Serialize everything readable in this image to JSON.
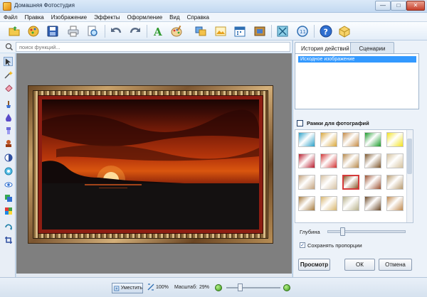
{
  "window": {
    "title": "Домашняя Фотостудия",
    "minimize": "—",
    "maximize": "□",
    "close": "✕"
  },
  "menu": [
    "Файл",
    "Правка",
    "Изображение",
    "Эффекты",
    "Оформление",
    "Вид",
    "Справка"
  ],
  "toolbar": {
    "icons": [
      "open-folder-icon",
      "gallery-icon",
      "save-icon",
      "print-icon",
      "preview-icon",
      "undo-icon",
      "redo-icon",
      "text-icon",
      "palette-icon",
      "collage-icon",
      "postcard-icon",
      "calendar-icon",
      "frame-icon",
      "crop-icon",
      "screen-icon",
      "help-icon",
      "box-icon"
    ]
  },
  "search": {
    "placeholder": "поиск функций..."
  },
  "left_tools": [
    "cursor-icon",
    "magic-wand-icon",
    "eraser-icon",
    "brush-icon",
    "drop-icon",
    "dodge-icon",
    "stamp-icon",
    "contrast-icon",
    "color-icon",
    "red-eye-icon",
    "layers-icon",
    "mixer-icon",
    "rotate-icon",
    "crop-tool-icon"
  ],
  "right_panel": {
    "tabs": [
      "История действий",
      "Сценарии"
    ],
    "history_items": [
      "Исходное изображение"
    ],
    "frames_title": "Рамки для фотографий",
    "depth_label": "Глубина",
    "depth_value": 0.2,
    "keep_proportions_label": "Сохранять пропорции",
    "keep_proportions_checked": true,
    "buttons": {
      "preview": "Просмотр",
      "ok": "ОК",
      "cancel": "Отмена"
    }
  },
  "frame_thumbs": [
    [
      "#2aa0c8",
      "#d9a63a",
      "#c58a44",
      "#1a9b2a",
      "#f3e21e"
    ],
    [
      "#b7192a",
      "#d23232",
      "#b78849",
      "#7c5429",
      "#d5c19c"
    ],
    [
      "#c3a27c",
      "#d6c1a2",
      "#8a5a2c",
      "#9b4f2e",
      "#b89a6e"
    ],
    [
      "#a77b3e",
      "#d8b56c",
      "#b7b089",
      "#6b4726",
      "#c0884c"
    ]
  ],
  "selected_thumb": "row3-col3",
  "statusbar": {
    "fit_label": "Уместить",
    "actual_label": "100%",
    "zoom_label": "Масштаб:",
    "zoom_value": "29%",
    "zoom_level": 0.29
  }
}
